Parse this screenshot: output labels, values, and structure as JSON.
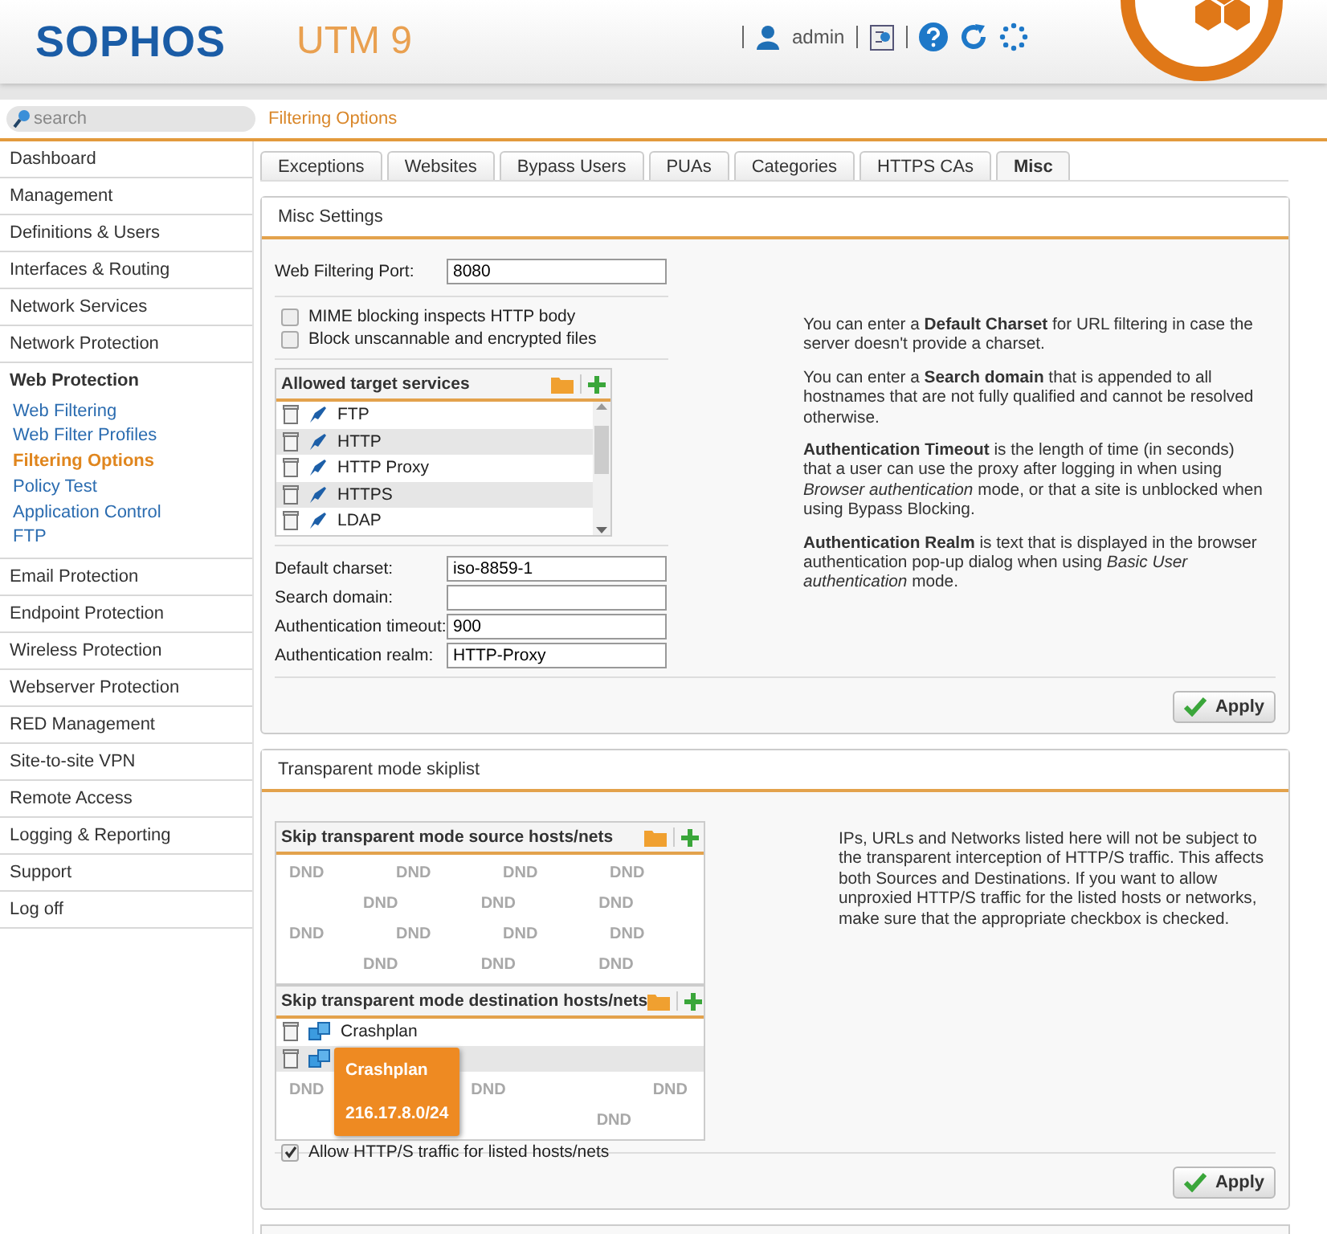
{
  "header": {
    "brand": "SOPHOS",
    "product": "UTM 9",
    "user": "admin"
  },
  "search": {
    "placeholder": "search"
  },
  "breadcrumb": "Filtering Options",
  "sidebar": {
    "items": [
      {
        "label": "Dashboard",
        "expanded": false
      },
      {
        "label": "Management",
        "expanded": false
      },
      {
        "label": "Definitions & Users",
        "expanded": false
      },
      {
        "label": "Interfaces & Routing",
        "expanded": false
      },
      {
        "label": "Network Services",
        "expanded": false
      },
      {
        "label": "Network Protection",
        "expanded": false
      },
      {
        "label": "Web Protection",
        "expanded": true,
        "children": [
          {
            "label": "Web Filtering",
            "selected": false
          },
          {
            "label": "Web Filter Profiles",
            "selected": false
          },
          {
            "label": "Filtering Options",
            "selected": true
          },
          {
            "label": "Policy Test",
            "selected": false
          },
          {
            "label": "Application Control",
            "selected": false
          },
          {
            "label": "FTP",
            "selected": false
          }
        ]
      },
      {
        "label": "Email Protection",
        "expanded": false
      },
      {
        "label": "Endpoint Protection",
        "expanded": false
      },
      {
        "label": "Wireless Protection",
        "expanded": false
      },
      {
        "label": "Webserver Protection",
        "expanded": false
      },
      {
        "label": "RED Management",
        "expanded": false
      },
      {
        "label": "Site-to-site VPN",
        "expanded": false
      },
      {
        "label": "Remote Access",
        "expanded": false
      },
      {
        "label": "Logging & Reporting",
        "expanded": false
      },
      {
        "label": "Support",
        "expanded": false
      },
      {
        "label": "Log off",
        "expanded": false
      }
    ]
  },
  "tabs": [
    {
      "label": "Exceptions",
      "selected": false
    },
    {
      "label": "Websites",
      "selected": false
    },
    {
      "label": "Bypass Users",
      "selected": false
    },
    {
      "label": "PUAs",
      "selected": false
    },
    {
      "label": "Categories",
      "selected": false
    },
    {
      "label": "HTTPS CAs",
      "selected": false
    },
    {
      "label": "Misc",
      "selected": true
    }
  ],
  "misc_settings": {
    "title": "Misc Settings",
    "port": {
      "label": "Web Filtering Port:",
      "value": "8080"
    },
    "options": [
      {
        "label": "MIME blocking inspects HTTP body",
        "checked": false
      },
      {
        "label": "Block unscannable and encrypted files",
        "checked": false
      }
    ],
    "services": {
      "title": "Allowed target services",
      "items": [
        {
          "kind": "service",
          "name": "FTP"
        },
        {
          "kind": "service",
          "name": "HTTP"
        },
        {
          "kind": "service",
          "name": "HTTP Proxy"
        },
        {
          "kind": "service",
          "name": "HTTPS"
        },
        {
          "kind": "service",
          "name": "LDAP"
        }
      ]
    },
    "fields": [
      {
        "label": "Default charset:",
        "value": "iso-8859-1"
      },
      {
        "label": "Search domain:"
      },
      {
        "label": "Authentication timeout:",
        "value": "900"
      },
      {
        "label": "Authentication realm:",
        "value": "HTTP-Proxy"
      }
    ],
    "help": [
      "You can enter a **Default Charset** for URL filtering in case the server doesn't provide a charset.",
      "You can enter a **Search domain** that is appended to all hostnames that are not fully qualified and cannot be resolved otherwise.",
      "**Authentication Timeout** is the length of time (in seconds) that a user can use the proxy after logging in when using *Browser authentication* mode, or that a site is unblocked when using Bypass Blocking.",
      "**Authentication Realm** is text that is displayed in the browser authentication pop-up dialog when using *Basic User authentication* mode."
    ],
    "apply": "Apply"
  },
  "skiplist": {
    "title": "Transparent mode skiplist",
    "source": {
      "title": "Skip transparent mode source hosts/nets",
      "drop_hints": [
        [
          "DND",
          "DND",
          "DND",
          "DND"
        ],
        [
          "DND",
          "DND",
          "DND"
        ],
        [
          "DND",
          "DND",
          "DND",
          "DND"
        ],
        [
          "DND",
          "DND",
          "DND"
        ]
      ]
    },
    "destination": {
      "title": "Skip transparent mode destination hosts/nets",
      "items": [
        {
          "kind": "network",
          "name": "Crashplan"
        },
        {
          "kind": "network"
        }
      ],
      "drop_hints": [
        [
          "DND",
          "DND",
          "DND"
        ],
        [
          "DND"
        ]
      ],
      "tooltip": {
        "title": "Crashplan",
        "value": "216.17.8.0/24"
      }
    },
    "allow": {
      "label": "Allow HTTP/S traffic for listed hosts/nets",
      "checked": true
    },
    "help": "IPs, URLs and Networks listed here will not be subject to the transparent interception of HTTP/S traffic. This affects both Sources and Destinations. If you want to allow unproxied HTTP/S traffic for the listed hosts or networks, make sure that the appropriate checkbox is checked.",
    "apply": "Apply"
  }
}
